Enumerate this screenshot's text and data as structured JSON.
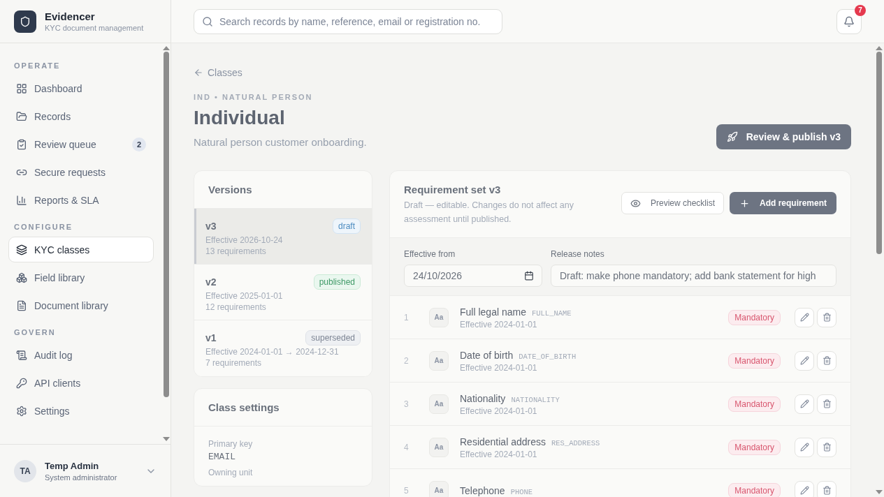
{
  "brand": {
    "name": "Evidencer",
    "tagline": "KYC document management"
  },
  "sidebar": {
    "sections": [
      {
        "label": "OPERATE",
        "items": [
          {
            "label": "Dashboard",
            "selected": false
          },
          {
            "label": "Records",
            "selected": false
          },
          {
            "label": "Review queue",
            "selected": false,
            "badge": "2"
          },
          {
            "label": "Secure requests",
            "selected": false
          },
          {
            "label": "Reports & SLA",
            "selected": false
          }
        ]
      },
      {
        "label": "CONFIGURE",
        "items": [
          {
            "label": "KYC classes",
            "selected": true
          },
          {
            "label": "Field library",
            "selected": false
          },
          {
            "label": "Document library",
            "selected": false
          }
        ]
      },
      {
        "label": "GOVERN",
        "items": [
          {
            "label": "Audit log",
            "selected": false
          },
          {
            "label": "API clients",
            "selected": false
          },
          {
            "label": "Settings",
            "selected": false
          }
        ]
      }
    ]
  },
  "user": {
    "initials": "TA",
    "name": "Temp Admin",
    "role": "System administrator"
  },
  "search": {
    "placeholder": "Search records by name, reference, email or registration no."
  },
  "notifications": {
    "count": "7"
  },
  "back_link": "Classes",
  "eyebrow": "IND • NATURAL PERSON",
  "title": "Individual",
  "subtitle": "Natural person customer onboarding.",
  "publish_button": "Review & publish v3",
  "versions": {
    "title": "Versions",
    "items": [
      {
        "name": "v3",
        "status": "draft",
        "kind": "draft",
        "effective": "Effective 2026-10-24",
        "count": "13 requirements",
        "selected": true
      },
      {
        "name": "v2",
        "status": "published",
        "kind": "published",
        "effective": "Effective 2025-01-01",
        "count": "12 requirements",
        "selected": false
      },
      {
        "name": "v1",
        "status": "superseded",
        "kind": "superseded",
        "effective": "Effective 2024-01-01 → 2024-12-31",
        "count": "7 requirements",
        "selected": false
      }
    ]
  },
  "class_settings": {
    "title": "Class settings",
    "fields": [
      {
        "label": "Primary key",
        "value": "EMAIL"
      },
      {
        "label": "Owning unit"
      }
    ]
  },
  "requirement_set": {
    "title": "Requirement set v3",
    "description": "Draft — editable. Changes do not affect any assessment until published.",
    "preview_button": "Preview checklist",
    "add_button": "Add requirement",
    "effective_label": "Effective from",
    "effective_value": "24/10/2026",
    "notes_label": "Release notes",
    "notes_value": "Draft: make phone mandatory; add bank statement for high",
    "rows": [
      {
        "index": "1",
        "type_icon": "Aa",
        "name": "Full legal name",
        "code": "FULL_NAME",
        "effective": "Effective 2024-01-01",
        "tag": "Mandatory"
      },
      {
        "index": "2",
        "type_icon": "Aa",
        "name": "Date of birth",
        "code": "DATE_OF_BIRTH",
        "effective": "Effective 2024-01-01",
        "tag": "Mandatory"
      },
      {
        "index": "3",
        "type_icon": "Aa",
        "name": "Nationality",
        "code": "NATIONALITY",
        "effective": "Effective 2024-01-01",
        "tag": "Mandatory"
      },
      {
        "index": "4",
        "type_icon": "Aa",
        "name": "Residential address",
        "code": "RES_ADDRESS",
        "effective": "Effective 2024-01-01",
        "tag": "Mandatory"
      },
      {
        "index": "5",
        "type_icon": "Aa",
        "name": "Telephone",
        "code": "PHONE",
        "tag": "Mandatory"
      }
    ]
  }
}
